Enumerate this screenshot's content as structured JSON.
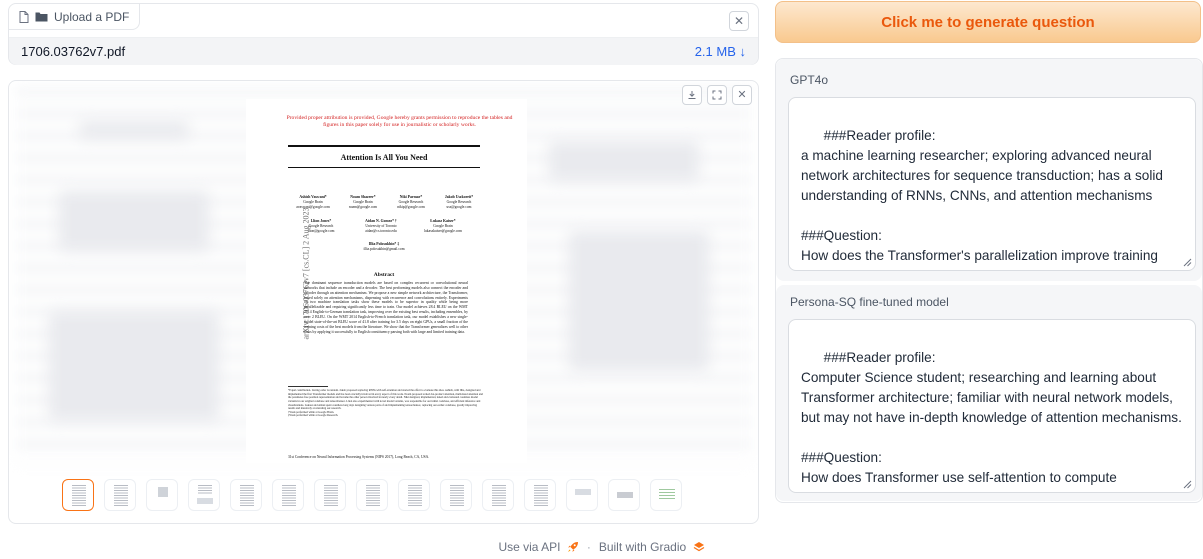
{
  "upload": {
    "label": "Upload a PDF",
    "file_name": "1706.03762v7.pdf",
    "file_size": "2.1 MB ↓"
  },
  "pdf": {
    "notice": "Provided proper attribution is provided, Google hereby grants permission to reproduce the tables and figures in this paper solely for use in journalistic or scholarly works.",
    "title": "Attention Is All You Need",
    "arxiv_id": "arXiv:1706.03762v7  [cs.CL]  2 Aug 2023",
    "authors": [
      {
        "name": "Ashish Vaswani*",
        "org": "Google Brain",
        "email": "avaswani@google.com"
      },
      {
        "name": "Noam Shazeer*",
        "org": "Google Brain",
        "email": "noam@google.com"
      },
      {
        "name": "Niki Parmar*",
        "org": "Google Research",
        "email": "nikip@google.com"
      },
      {
        "name": "Jakob Uszkoreit*",
        "org": "Google Research",
        "email": "usz@google.com"
      },
      {
        "name": "Llion Jones*",
        "org": "Google Research",
        "email": "llion@google.com"
      },
      {
        "name": "Aidan N. Gomez* †",
        "org": "University of Toronto",
        "email": "aidan@cs.toronto.edu"
      },
      {
        "name": "Łukasz Kaiser*",
        "org": "Google Brain",
        "email": "lukaszkaiser@google.com"
      },
      {
        "name": "Illia Polosukhin* ‡",
        "org": "",
        "email": "illia.polosukhin@gmail.com"
      }
    ],
    "abstract_heading": "Abstract",
    "abstract": "The dominant sequence transduction models are based on complex recurrent or convolutional neural networks that include an encoder and a decoder. The best performing models also connect the encoder and decoder through an attention mechanism. We propose a new simple network architecture, the Transformer, based solely on attention mechanisms, dispensing with recurrence and convolutions entirely. Experiments on two machine translation tasks show these models to be superior in quality while being more parallelizable and requiring significantly less time to train. Our model achieves 28.4 BLEU on the WMT 2014 English-to-German translation task, improving over the existing best results, including ensembles, by over 2 BLEU. On the WMT 2014 English-to-French translation task, our model establishes a new single-model state-of-the-art BLEU score of 41.8 after training for 3.5 days on eight GPUs, a small fraction of the training costs of the best models from the literature. We show that the Transformer generalizes well to other tasks by applying it successfully to English constituency parsing both with large and limited training data.",
    "footnote": "*Equal contribution. Listing order is random. Jakob proposed replacing RNNs with self-attention and started the effort to evaluate this idea. Ashish, with Illia, designed and implemented the first Transformer models and has been crucially involved in every aspect of this work. Noam proposed scaled dot-product attention, multi-head attention and the parameter-free position representation and became the other person involved in nearly every detail. Niki designed, implemented, tuned and evaluated countless model variants in our original codebase and tensor2tensor. Llion also experimented with novel model variants, was responsible for our initial codebase, and efficient inference and visualizations. Lukasz and Aidan spent countless long days designing various parts of and implementing tensor2tensor, replacing our earlier codebase, greatly improving results and massively accelerating our research.\n†Work performed while at Google Brain.\n‡Work performed while at Google Research.",
    "conference": "31st Conference on Neural Information Processing Systems (NIPS 2017), Long Beach, CA, USA."
  },
  "generate_button": "Click me to generate question",
  "outputs": [
    {
      "label": "GPT4o",
      "text": "###Reader profile:\na machine learning researcher; exploring advanced neural network architectures for sequence transduction; has a solid understanding of RNNs, CNNs, and attention mechanisms\n\n###Question:\nHow does the Transformer's parallelization improve training efficiency?"
    },
    {
      "label": "Persona-SQ fine-tuned model",
      "text": "###Reader profile:\nComputer Science student; researching and learning about Transformer architecture; familiar with neural network models, but may not have in-depth knowledge of attention mechanisms.\n\n###Question:\nHow does Transformer use self-attention to compute representations?"
    }
  ],
  "footer": {
    "api": "Use via API",
    "sep": "·",
    "built": "Built with Gradio"
  },
  "colors": {
    "accent": "#ea580c",
    "link": "#2563eb",
    "button_gradient_top": "#fde8cf",
    "button_gradient_bottom": "#f9c98f"
  }
}
